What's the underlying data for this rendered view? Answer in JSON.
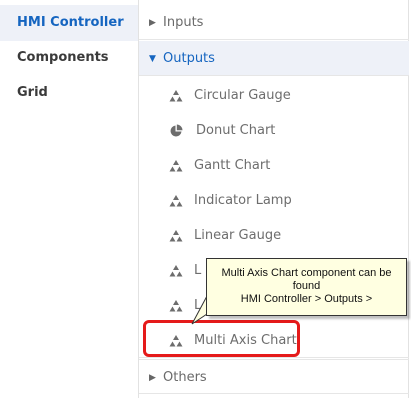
{
  "sidebar": {
    "items": [
      {
        "label": "HMI Controller",
        "active": true
      },
      {
        "label": "Components",
        "active": false
      },
      {
        "label": "Grid",
        "active": false
      }
    ]
  },
  "tree": {
    "inputs": {
      "label": "Inputs",
      "icon": "caret-right-icon"
    },
    "outputs": {
      "label": "Outputs",
      "icon": "caret-down-icon"
    },
    "others": {
      "label": "Others",
      "icon": "caret-right-icon"
    },
    "children": [
      {
        "label": "Circular Gauge",
        "icon": "component-icon"
      },
      {
        "label": "Donut Chart",
        "icon": "pie-chart-icon"
      },
      {
        "label": "Gantt Chart",
        "icon": "component-icon"
      },
      {
        "label": "Indicator Lamp",
        "icon": "component-icon"
      },
      {
        "label": "Linear Gauge",
        "icon": "component-icon"
      },
      {
        "label": "L",
        "icon": "component-icon"
      },
      {
        "label": "L",
        "icon": "component-icon"
      },
      {
        "label": "Multi Axis Chart",
        "icon": "component-icon"
      }
    ]
  },
  "callout": {
    "line1": "Multi Axis Chart component can be found",
    "line2": "HMI Controller > Outputs >"
  },
  "colors": {
    "accent": "#1565c0",
    "highlight": "#e51a1a",
    "callout_bg": "#ffffe1"
  }
}
